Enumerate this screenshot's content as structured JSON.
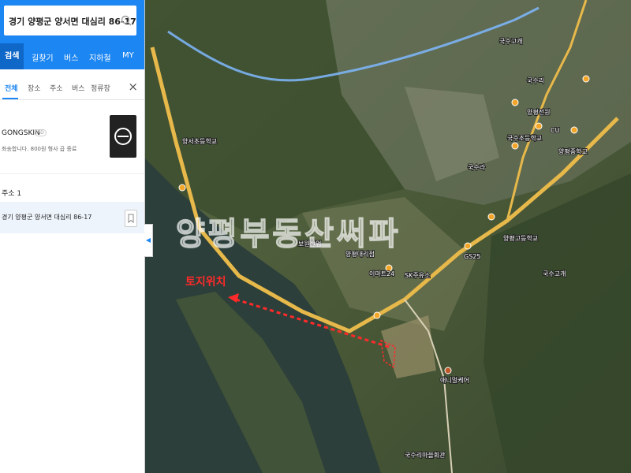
{
  "search": {
    "query": "경기 양평군 양서면 대심리 86-17"
  },
  "nav": {
    "tabs": [
      "검색",
      "길찾기",
      "버스",
      "지하철",
      "MY"
    ]
  },
  "categories": [
    "전체",
    "장소",
    "주소",
    "버스",
    "정류장"
  ],
  "ad": {
    "name": "GONGSKIN",
    "badge": "AD",
    "desc": "좌송합니다. 800원 형사 곱 종료"
  },
  "address": {
    "heading": "주소 1",
    "item": "경기 양평군 양서면 대심리 86-17"
  },
  "map": {
    "watermark": "양평부동산써파",
    "land_label": "토지위치",
    "labels": [
      "양서초등학교",
      "국수고개",
      "국수리",
      "양평전원",
      "국수조등학교",
      "이마트24",
      "SK주유소",
      "보원산업",
      "양평대리점",
      "GS25",
      "CU",
      "국수고개",
      "국수라",
      "양평고등학교",
      "국수리마을회관",
      "애니멀케어",
      "양평중학교"
    ]
  },
  "colors": {
    "brand": "#1c86f2",
    "land_marker": "#ff2a2a",
    "road": "#e7b84a",
    "rail": "#7fb8ff",
    "river": "#2c3f3a"
  }
}
